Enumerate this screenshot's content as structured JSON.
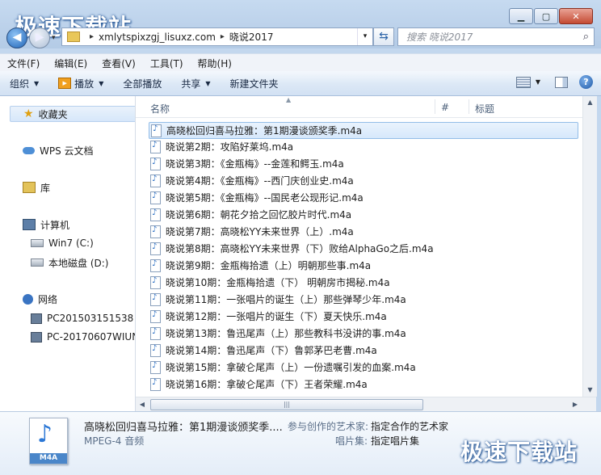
{
  "watermark": "极速下载站",
  "address": {
    "crumbs": [
      "xmlytspixzgj_lisuxz.com",
      "晓说2017"
    ],
    "separator": "▸"
  },
  "search": {
    "placeholder": "搜索 晓说2017"
  },
  "menu": [
    "文件(F)",
    "编辑(E)",
    "查看(V)",
    "工具(T)",
    "帮助(H)"
  ],
  "toolbar": {
    "organize": "组织",
    "play": "播放",
    "play_all": "全部播放",
    "share": "共享",
    "new_folder": "新建文件夹"
  },
  "nav": {
    "favorites": "收藏夹",
    "wps": "WPS 云文档",
    "libraries": "库",
    "computer": "计算机",
    "drive_c": "Win7 (C:)",
    "drive_d": "本地磁盘 (D:)",
    "network": "网络",
    "pc1": "PC201503151538",
    "pc2": "PC-20170607WIUN"
  },
  "columns": {
    "name": "名称",
    "number": "#",
    "title": "标题"
  },
  "files": [
    "高晓松回归喜马拉雅：第1期漫谈颁奖季.m4a",
    "晓说第2期：攻陷好莱坞.m4a",
    "晓说第3期：《金瓶梅》--金莲和鳄玉.m4a",
    "晓说第4期：《金瓶梅》--西门庆创业史.m4a",
    "晓说第5期：《金瓶梅》--国民老公现形记.m4a",
    "晓说第6期：朝花夕拾之回忆胶片时代.m4a",
    "晓说第7期：高晓松YY未来世界（上）.m4a",
    "晓说第8期：高晓松YY未来世界（下）败给AlphaGo之后.m4a",
    "晓说第9期：金瓶梅拾遗（上）明朝那些事.m4a",
    "晓说第10期：金瓶梅拾遗（下） 明朝房市揭秘.m4a",
    "晓说第11期：一张唱片的诞生（上）那些弹琴少年.m4a",
    "晓说第12期：一张唱片的诞生（下）夏天快乐.m4a",
    "晓说第13期：鲁迅尾声（上）那些教科书没讲的事.m4a",
    "晓说第14期：鲁迅尾声（下）鲁郭茅巴老曹.m4a",
    "晓说第15期：拿破仑尾声（上）一份遗嘱引发的血案.m4a",
    "晓说第16期：拿破仑尾声（下）王者荣耀.m4a"
  ],
  "details": {
    "name": "高晓松回归喜马拉雅：第1期漫谈颁奖季....",
    "type": "MPEG-4 音频",
    "icon_label": "M4A",
    "artist_key": "参与创作的艺术家:",
    "artist_val": "指定合作的艺术家",
    "album_key": "唱片集:",
    "album_val": "指定唱片集"
  },
  "colors": {
    "selection": "#d6e8fb",
    "accent": "#1e63b6"
  }
}
